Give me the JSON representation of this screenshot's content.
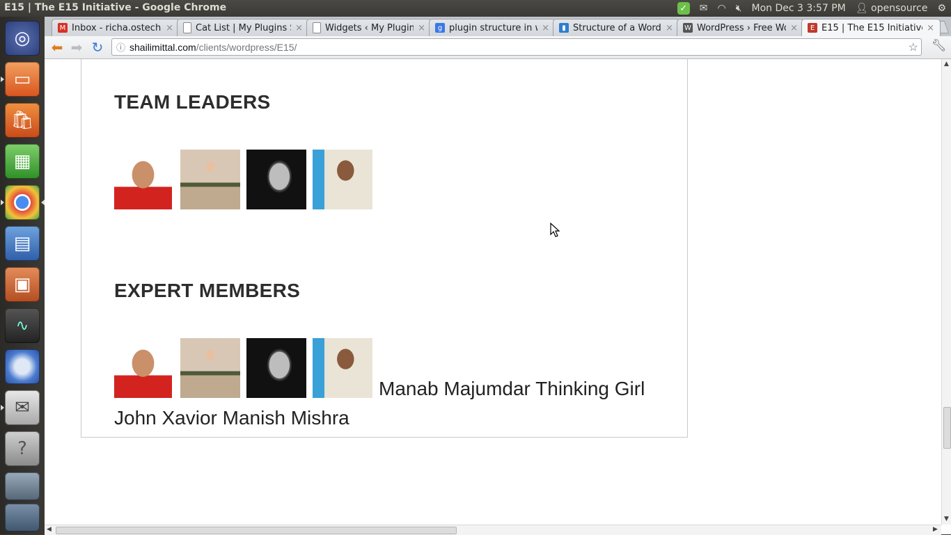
{
  "window": {
    "title": "E15 | The E15 Initiative - Google Chrome"
  },
  "tray": {
    "clock": "Mon Dec  3  3:57 PM",
    "user": "opensource"
  },
  "tabs": [
    {
      "label": "Inbox - richa.ostech@gr",
      "favicon": "gmail-icon",
      "fav_color": "#d93025"
    },
    {
      "label": "Cat List | My Plugins Site",
      "favicon": "page-icon",
      "fav_color": "#8a8a8a"
    },
    {
      "label": "Widgets ‹ My Plugins Sit",
      "favicon": "page-icon",
      "fav_color": "#8a8a8a"
    },
    {
      "label": "plugin structure in word",
      "favicon": "google-icon",
      "fav_color": "#3b78e7"
    },
    {
      "label": "Structure of a Wordpre",
      "favicon": "bookmark-icon",
      "fav_color": "#2e7dd1"
    },
    {
      "label": "WordPress › Free WordP",
      "favicon": "wordpress-icon",
      "fav_color": "#555555"
    },
    {
      "label": "E15 | The E15 Initiative",
      "favicon": "e15-icon",
      "fav_color": "#c0392b"
    }
  ],
  "address": {
    "host": "shailimittal.com",
    "path": "/clients/wordpress/E15/"
  },
  "page": {
    "team_leaders_title": "TEAM LEADERS",
    "expert_members_title": "EXPERT MEMBERS",
    "member_names": [
      "Manab Majumdar",
      "Thinking Girl",
      "John Xavior",
      "Manish Mishra"
    ]
  },
  "colors": {
    "accent_green": "#6cc04a",
    "launcher_orange": "#e2702f"
  }
}
